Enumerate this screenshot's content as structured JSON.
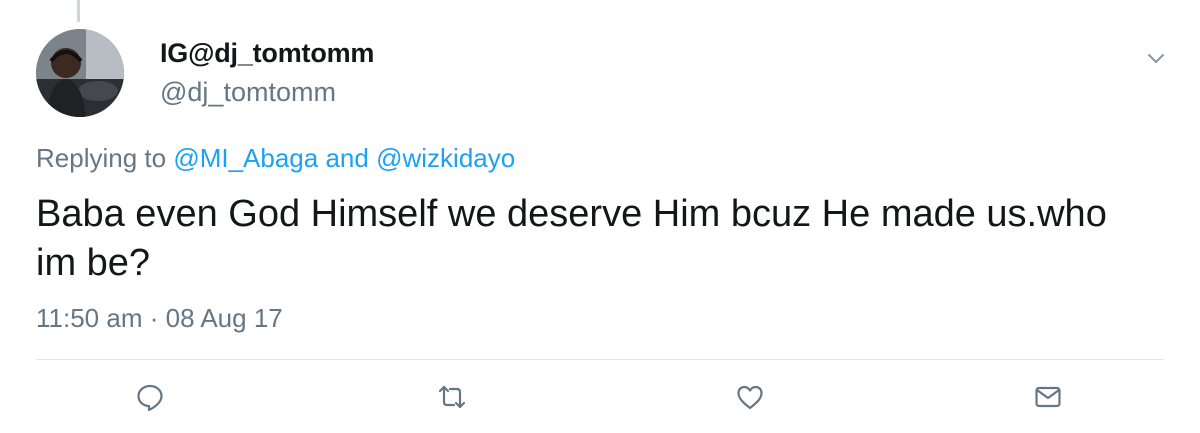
{
  "tweet": {
    "display_name": "IG@dj_tomtomm",
    "handle": "@dj_tomtomm",
    "replying_prefix": "Replying to",
    "reply_mention_1": "@MI_Abaga",
    "reply_conjunction": "and",
    "reply_mention_2": "@wizkidayo",
    "text": "Baba even God Himself we deserve Him bcuz He made us.who im be?",
    "time": "11:50 am",
    "separator": "·",
    "date": "08 Aug 17"
  },
  "icons": {
    "menu": "chevron-down-icon",
    "reply": "reply-icon",
    "retweet": "retweet-icon",
    "like": "heart-icon",
    "message": "envelope-icon"
  },
  "colors": {
    "link": "#1da1f2",
    "secondary_text": "#657786",
    "primary_text": "#14171a",
    "divider": "#e1e8ed"
  }
}
